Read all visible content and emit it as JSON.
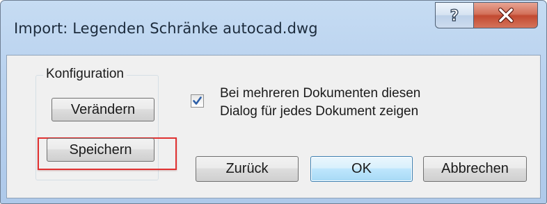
{
  "window": {
    "title": "Import: Legenden Schränke autocad.dwg",
    "help_button_label": "?",
    "close_button_icon": "close-icon"
  },
  "configuration_group": {
    "label": "Konfiguration",
    "change_button_label": "Verändern",
    "save_button_label": "Speichern"
  },
  "option": {
    "checked": true,
    "line1": "Bei mehreren Dokumenten diesen",
    "line2": "Dialog für jedes Dokument zeigen"
  },
  "footer": {
    "back_button_label": "Zurück",
    "ok_button_label": "OK",
    "cancel_button_label": "Abbrechen"
  },
  "colors": {
    "highlight_border": "#e03131",
    "close_button": "#c24a31",
    "default_button_border": "#3c7fb1"
  }
}
